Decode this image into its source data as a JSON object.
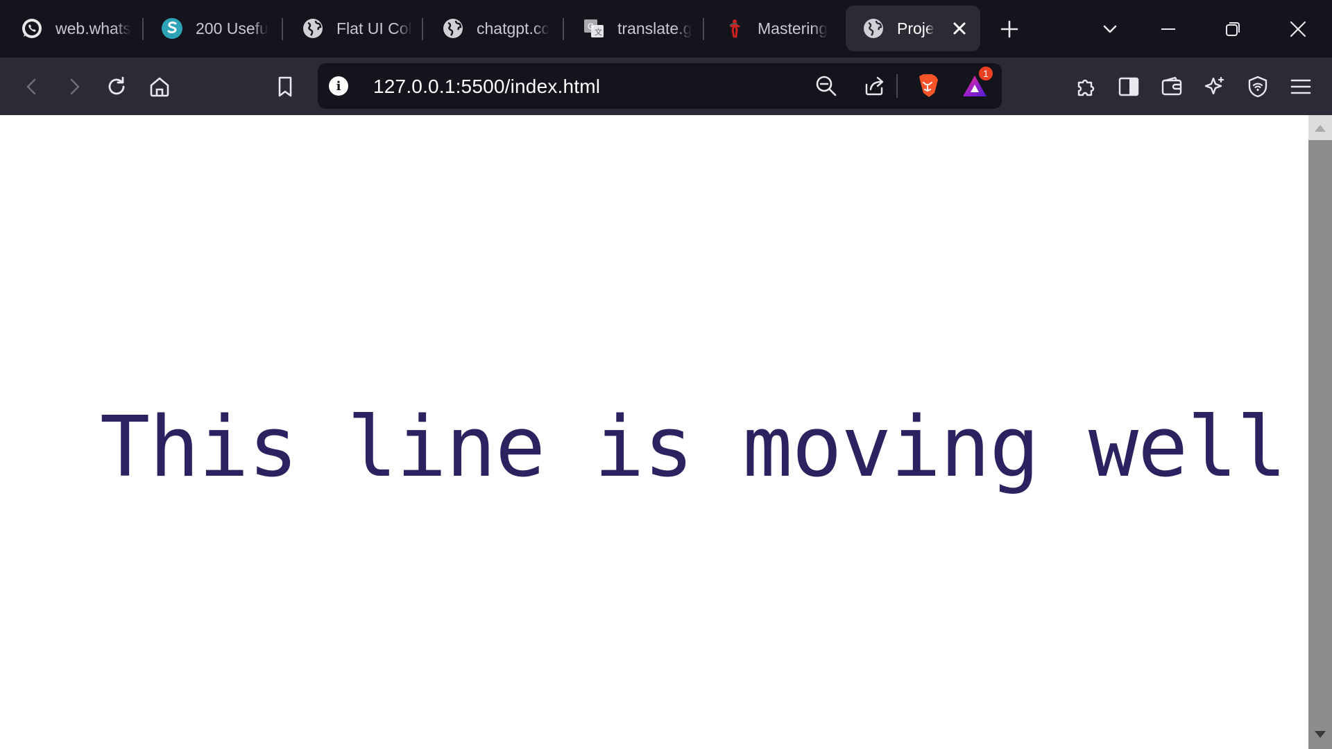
{
  "tabs": [
    {
      "label": "web.whats",
      "icon": "whatsapp-icon"
    },
    {
      "label": "200 Usefu",
      "icon": "s-logo-icon"
    },
    {
      "label": "Flat UI Col",
      "icon": "globe-icon"
    },
    {
      "label": "chatgpt.cc",
      "icon": "globe-icon"
    },
    {
      "label": "translate.g",
      "icon": "google-translate-icon"
    },
    {
      "label": "Mastering",
      "icon": "figure-icon"
    },
    {
      "label": "Proje",
      "icon": "globe-icon",
      "active": true
    }
  ],
  "address_bar": {
    "url": "127.0.0.1:5500/index.html"
  },
  "notifications": {
    "rewards_badge": "1"
  },
  "page": {
    "text": "This line is moving well",
    "text_color": "#2a2360"
  },
  "colors": {
    "tabstrip_bg": "#14141c",
    "toolbar_bg": "#2b2b36",
    "brave_orange": "#fb542b",
    "badge_red": "#ea3f23"
  }
}
